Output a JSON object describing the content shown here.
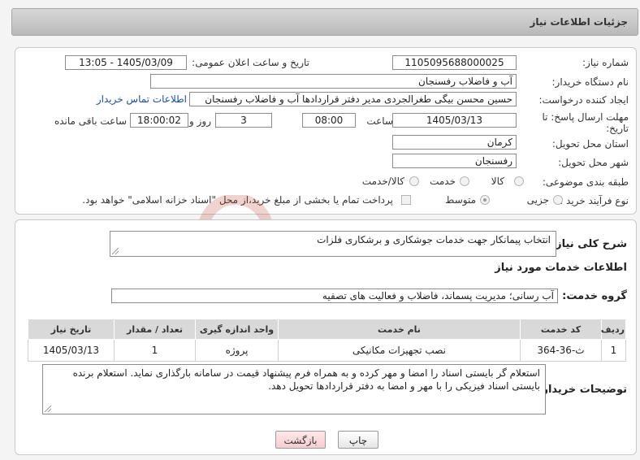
{
  "header": {
    "title": "جزئیات اطلاعات نیاز"
  },
  "form": {
    "need_number_label": "شماره نیاز:",
    "need_number": "1105095688000025",
    "announce_label": "تاریخ و ساعت اعلان عمومی:",
    "announce_value": "1405/03/09 - 13:05",
    "buyer_org_label": "نام دستگاه خریدار:",
    "buyer_org": "آب و فاضلاب رفسنجان",
    "creator_label": "ایجاد کننده درخواست:",
    "creator": "حسین محسن بیگی طغرالجردی مدیر دفتر قراردادها آب و فاضلاب رفسنجان",
    "contact_link": "اطلاعات تماس خریدار",
    "deadline_label": "مهلت ارسال پاسخ: تا تاریخ:",
    "deadline_date": "1405/03/13",
    "time_label": "ساعت",
    "deadline_time": "08:00",
    "days_value": "3",
    "days_label": "روز و",
    "remaining_time": "18:00:02",
    "remaining_label": "ساعت باقی مانده",
    "province_label": "استان محل تحویل:",
    "province": "کرمان",
    "city_label": "شهر محل تحویل:",
    "city": "رفسنجان",
    "category_label": "طبقه بندی موضوعی:",
    "category_options": [
      "کالا",
      "خدمت",
      "کالا/خدمت"
    ],
    "process_label": "نوع فرآیند خرید :",
    "process_options": [
      "جزیی",
      "متوسط"
    ],
    "payment_note": "پرداخت تمام یا بخشی از مبلغ خرید،از محل \"اسناد خزانه اسلامی\" خواهد بود."
  },
  "summary": {
    "label": "شرح کلی نیاز:",
    "value": "انتخاب پیمانکار جهت خدمات جوشکاری و برشکاری فلزات"
  },
  "services": {
    "section_title": "اطلاعات خدمات مورد نیاز",
    "group_label": "گروه خدمت:",
    "group_value": "آب رسانی؛ مدیریت پسماند، فاضلاب و فعالیت های تصفیه",
    "columns": [
      "ردیف",
      "کد خدمت",
      "نام خدمت",
      "واحد اندازه گیری",
      "تعداد / مقدار",
      "تاریخ نیاز"
    ],
    "rows": [
      [
        "1",
        "ث-36-364",
        "نصب تجهیزات مکانیکی",
        "پروژه",
        "1",
        "1405/03/13"
      ]
    ]
  },
  "buyer_notes": {
    "label": "توضیحات خریدار:",
    "value": "استعلام گر بایستی اسناد را امضا و مهر کرده و به همراه فرم پیشنهاد قیمت در سامانه بارگذاری نماید. استعلام برنده بایستی اسناد فیزیکی را با مهر و امضا به دفتر قراردادها تحویل دهد."
  },
  "buttons": {
    "print": "چاپ",
    "back": "بازگشت"
  },
  "watermark": {
    "text": "AriaTender.neT"
  },
  "colors": {
    "link": "#1f4ea1",
    "watermark": "#c0392b"
  }
}
